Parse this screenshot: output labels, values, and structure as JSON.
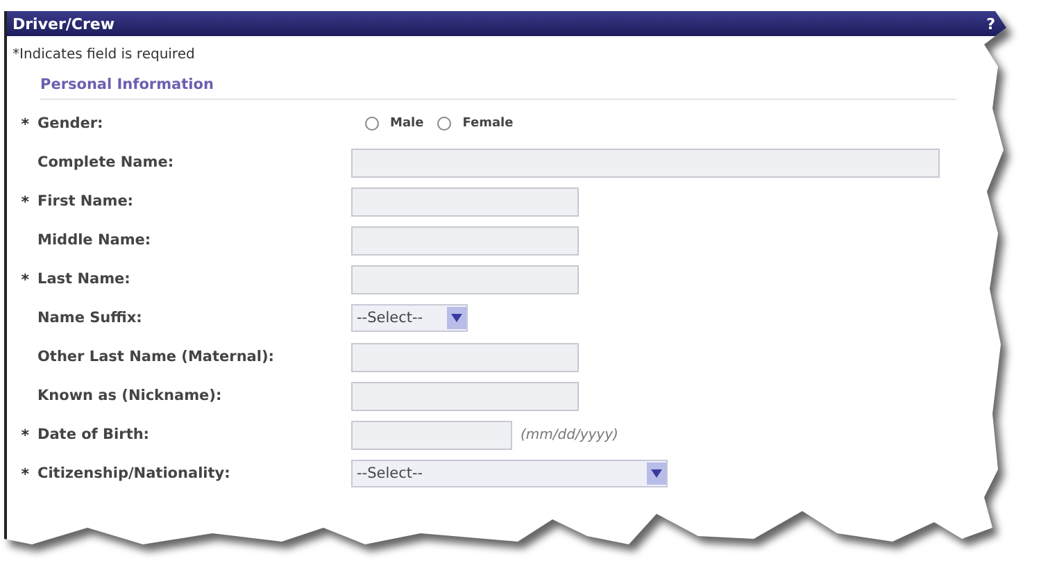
{
  "panel": {
    "title": "Driver/Crew",
    "help": "?"
  },
  "required_note": "*Indicates field is required",
  "section": {
    "legend": "Personal Information",
    "fields": [
      {
        "kind": "radio",
        "mark": "*",
        "label": "Gender:",
        "options": [
          {
            "label": "Male",
            "selected": false
          },
          {
            "label": "Female",
            "selected": false
          }
        ]
      },
      {
        "kind": "long-text",
        "label": "Complete Name:"
      },
      {
        "kind": "text",
        "mark": "*",
        "label": "First Name:"
      },
      {
        "kind": "text",
        "label": "Middle Name:"
      },
      {
        "kind": "text",
        "mark": "*",
        "label": "Last Name:"
      },
      {
        "kind": "small-select",
        "label": "Name Suffix:",
        "value": "--Select--"
      },
      {
        "kind": "text",
        "label": "Other Last Name (Maternal):"
      },
      {
        "kind": "text",
        "label": "Known as (Nickname):"
      },
      {
        "kind": "date",
        "mark": "*",
        "label": "Date of Birth:",
        "hint": "(mm/dd/yyyy)"
      },
      {
        "kind": "select",
        "mark": "*",
        "label": "Citizenship/Nationality:",
        "value": "--Select--"
      }
    ]
  }
}
